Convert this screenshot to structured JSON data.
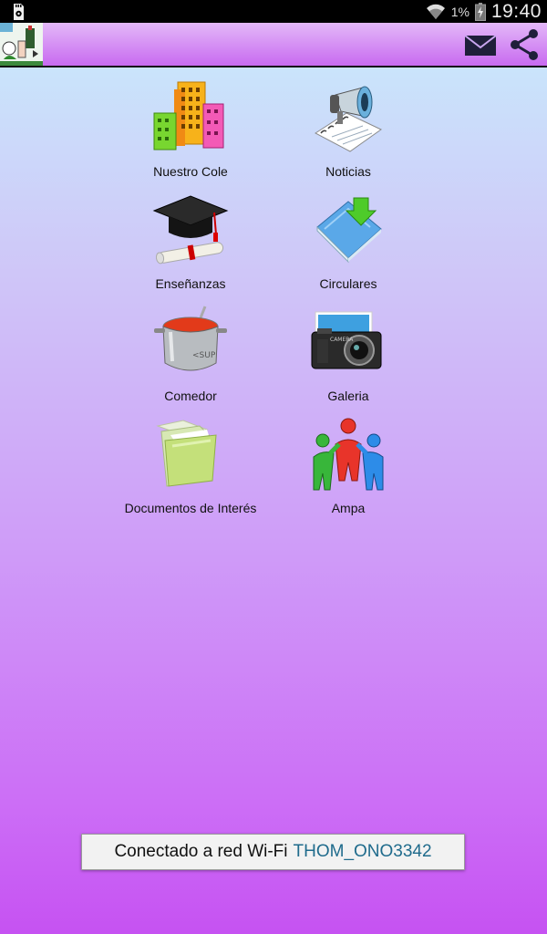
{
  "status_bar": {
    "battery_percent": "1%",
    "time": "19:40"
  },
  "action_bar": {
    "mail_icon": "mail-icon",
    "share_icon": "share-icon"
  },
  "menu": {
    "items": [
      {
        "label": "Nuestro Cole",
        "icon": "buildings-icon"
      },
      {
        "label": "Noticias",
        "icon": "megaphone-notebook-icon"
      },
      {
        "label": "Enseñanzas",
        "icon": "graduation-cap-icon"
      },
      {
        "label": "Circulares",
        "icon": "book-download-icon"
      },
      {
        "label": "Comedor",
        "icon": "cooking-pot-icon"
      },
      {
        "label": "Galeria",
        "icon": "camera-icon"
      },
      {
        "label": "Documentos de Interés",
        "icon": "folder-icon"
      },
      {
        "label": "Ampa",
        "icon": "people-group-icon"
      }
    ]
  },
  "toast": {
    "prefix": "Conectado a red Wi-Fi",
    "ssid": "THOM_ONO3342"
  },
  "colors": {
    "status_bar": "#000000",
    "action_bar": "#c86af0",
    "background_top": "#c8eefc",
    "background_bottom": "#c652f2",
    "ssid_text": "#1f6b8c"
  }
}
